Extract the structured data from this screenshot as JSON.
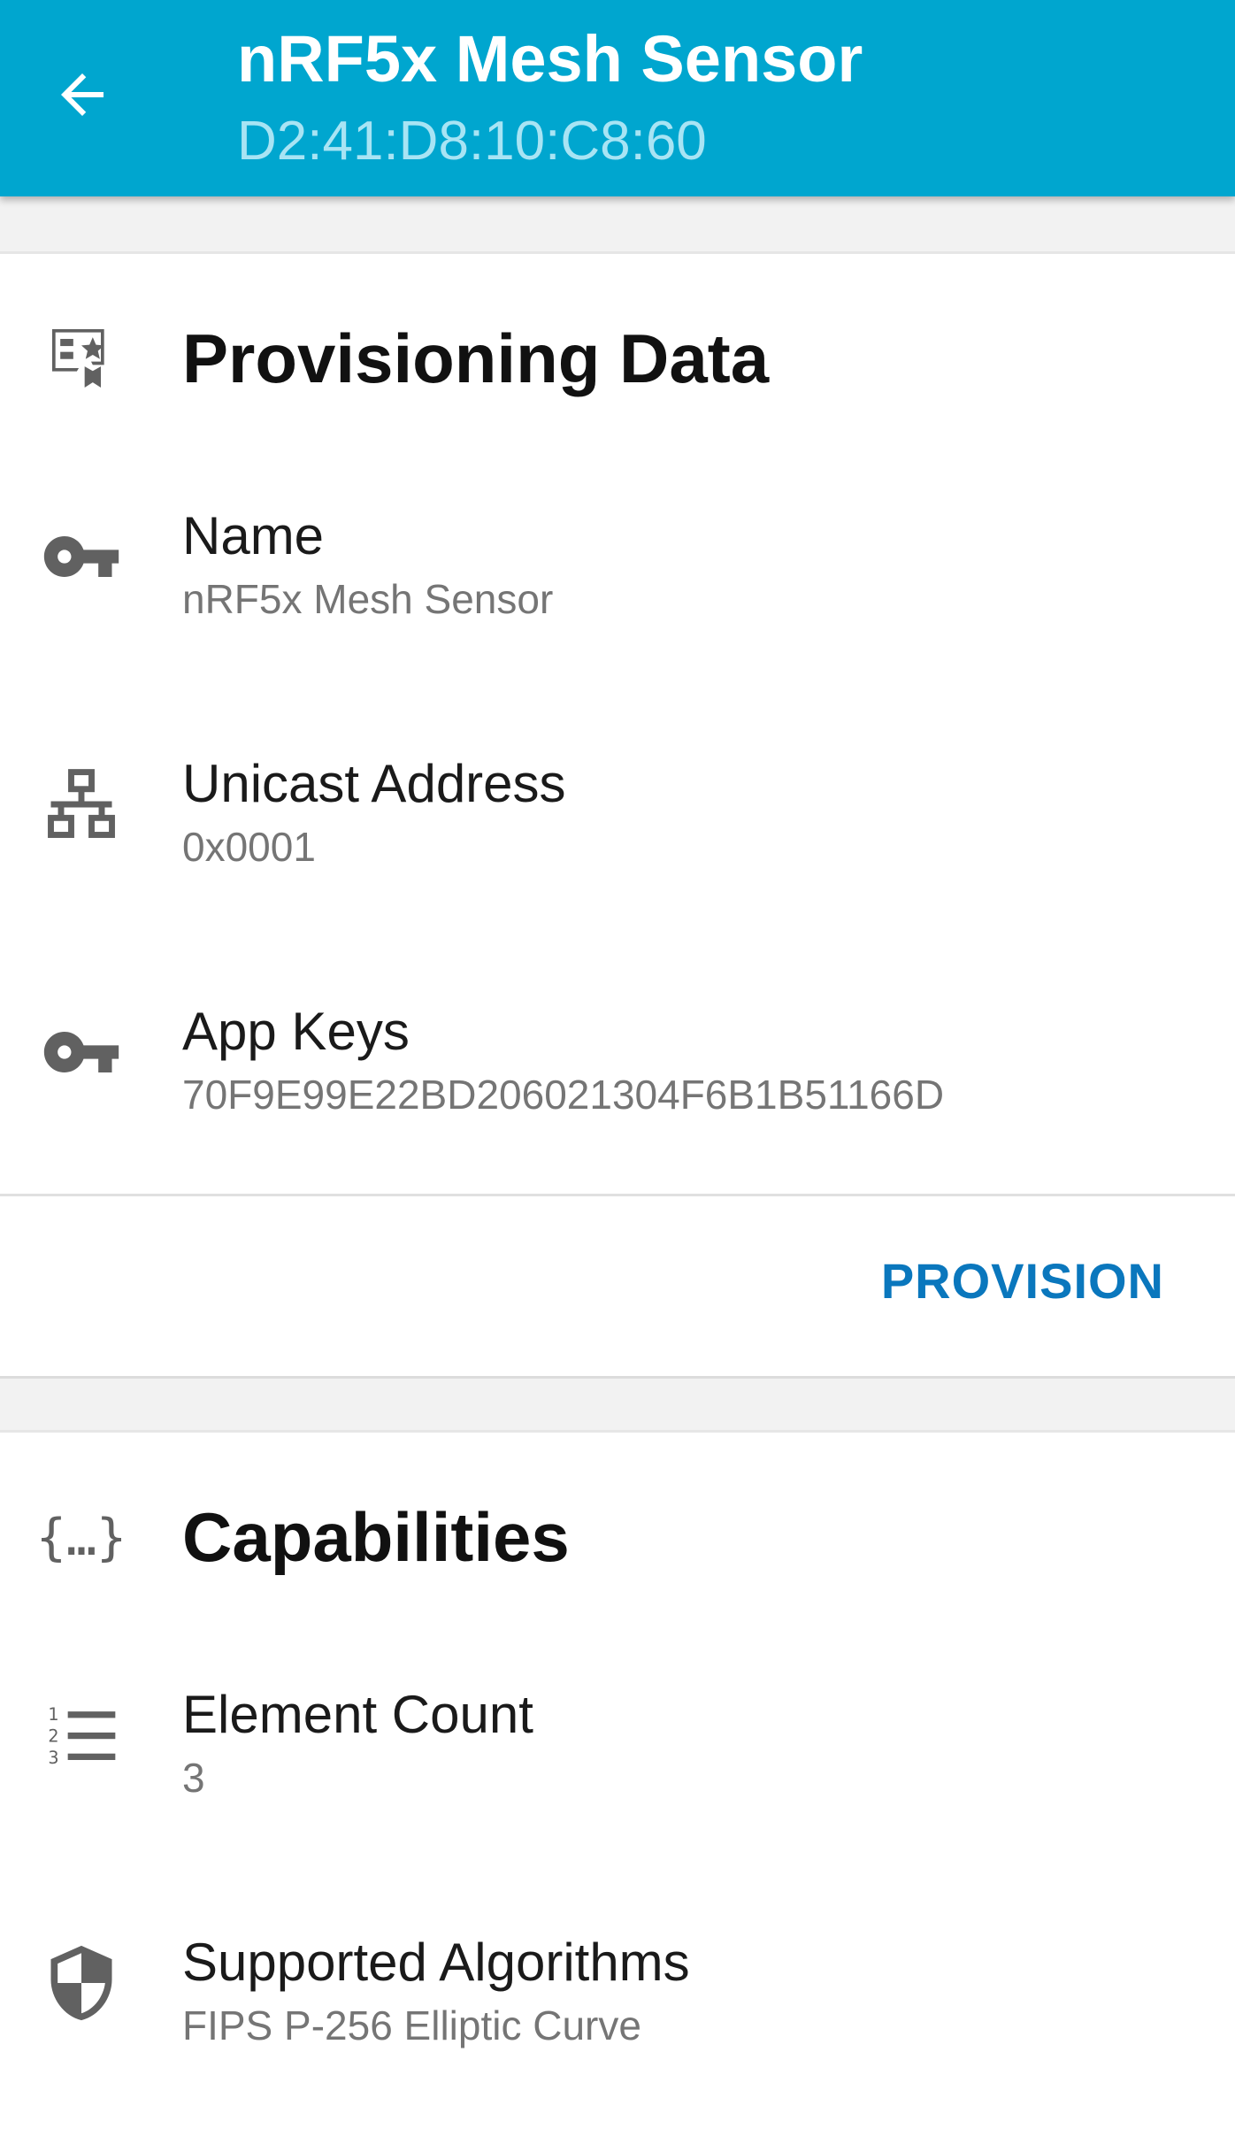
{
  "app_bar": {
    "title": "nRF5x Mesh Sensor",
    "subtitle": "D2:41:D8:10:C8:60",
    "back_icon": "arrow-back-icon",
    "background_color": "#00a6cf"
  },
  "provisioning": {
    "title": "Provisioning Data",
    "icon": "provisioning-data-icon",
    "rows": [
      {
        "label": "Name",
        "value": "nRF5x Mesh Sensor",
        "icon": "key-icon"
      },
      {
        "label": "Unicast Address",
        "value": "0x0001",
        "icon": "network-icon"
      },
      {
        "label": "App Keys",
        "value": "70F9E99E22BD206021304F6B1B51166D",
        "icon": "key-icon"
      }
    ],
    "action_label": "PROVISION",
    "action_color": "#0a77bd"
  },
  "capabilities": {
    "title": "Capabilities",
    "icon": "curly-braces-icon",
    "rows": [
      {
        "label": "Element Count",
        "value": "3",
        "icon": "numbered-list-icon"
      },
      {
        "label": "Supported Algorithms",
        "value": "FIPS P-256 Elliptic Curve",
        "icon": "shield-icon"
      }
    ]
  }
}
